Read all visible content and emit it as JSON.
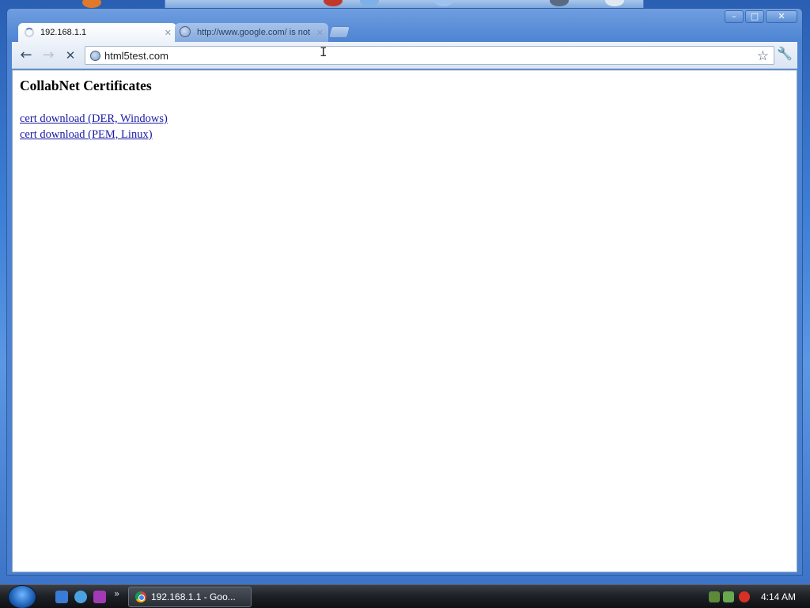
{
  "browser": {
    "tabs": [
      {
        "title": "192.168.1.1",
        "active": true,
        "loading": true
      },
      {
        "title": "http://www.google.com/ is not",
        "active": false,
        "loading": false
      }
    ],
    "window_controls": {
      "minimize": "–",
      "maximize": "□",
      "close": "✕"
    },
    "toolbar": {
      "back": "←",
      "forward": "→",
      "stop": "✕",
      "bookmark": "☆",
      "wrench": "🔧"
    },
    "address": {
      "url": "html5test.com"
    }
  },
  "page": {
    "heading": "CollabNet Certificates",
    "links": [
      "cert download (DER, Windows)",
      "cert download (PEM, Linux)"
    ]
  },
  "taskbar": {
    "quick_launch_more": "»",
    "task_button": "192.168.1.1 - Goo...",
    "clock": "4:14 AM"
  },
  "colors": {
    "link": "#1a1aa6",
    "window_frame": "#4f85d3",
    "taskbar": "#1c1f24"
  }
}
